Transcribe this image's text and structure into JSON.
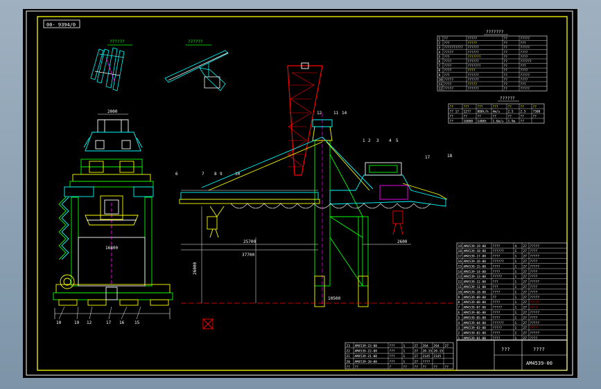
{
  "drawing": {
    "corner_code": "00- 9394/0",
    "sketch_label_1": "??????",
    "sketch_label_2": "??????",
    "spec_table_title": "???????",
    "param_table_title": "??????",
    "drawing_number": "AM4539-00",
    "title_block_name": "????",
    "title_block_name2": "???"
  },
  "dimensions": {
    "left_top": "2000",
    "left_mid": "16800",
    "main_span": "25700",
    "sub_span": "37700",
    "right_small": "2600",
    "vertical": "26000",
    "bottom_mid": "10500"
  },
  "callouts": {
    "side_view": [
      "1",
      "2",
      "3",
      "4",
      "5",
      "6",
      "7",
      "8",
      "9",
      "10",
      "11",
      "12",
      "13",
      "14",
      "17",
      "18"
    ],
    "front_view": [
      "10",
      "19",
      "12",
      "17",
      "16",
      "15"
    ]
  },
  "spec_table": [
    [
      "1",
      "??",
      "?????",
      "??",
      "?????"
    ],
    [
      "2",
      "???",
      "?????",
      "??",
      "???"
    ],
    [
      "3",
      "??????????",
      "??????",
      "??",
      "?????"
    ],
    [
      "4",
      "?????",
      "??????",
      "??",
      "????"
    ],
    [
      "5",
      "???",
      "???????",
      "??",
      "????"
    ],
    [
      "6",
      "????",
      "??????",
      "??",
      "??????"
    ],
    [
      "7",
      "????",
      "???????",
      "??",
      "???"
    ],
    [
      "8",
      "????",
      "????",
      "??",
      "????"
    ],
    [
      "9",
      "???",
      "??????",
      "??",
      "?????"
    ],
    [
      "10",
      "?????",
      "??????",
      "??",
      "????"
    ],
    [
      "11",
      "????",
      "?????",
      "??",
      "???"
    ],
    [
      "12",
      "?????",
      "??????",
      "??",
      "?????"
    ]
  ],
  "param_table": [
    [
      "??",
      "???",
      "???",
      "???",
      "??",
      "??",
      "??"
    ],
    [
      "?? 1?",
      "12??",
      "800t/h",
      "4m/s",
      "2.5",
      "2.5",
      "?500"
    ],
    [
      "??",
      "??",
      "??",
      "??",
      "??",
      "??",
      "??"
    ],
    [
      "??",
      "16000",
      "1400t",
      "1.6m/s",
      "1.9m",
      "??"
    ]
  ],
  "parts_list": [
    [
      "19",
      "AM4539-19-00",
      "????",
      "4",
      "27",
      "?????"
    ],
    [
      "18",
      "AM4539-18-00",
      "??????",
      "1",
      "27",
      "????"
    ],
    [
      "17",
      "AM4539-17-00",
      "????",
      "1",
      "27",
      "?????"
    ],
    [
      "16",
      "AM4539-16-00",
      "??????",
      "1",
      "27",
      "????"
    ],
    [
      "15",
      "AM4539-15-00",
      "????",
      "1",
      "27",
      "?????"
    ],
    [
      "14",
      "AM4539-14-00",
      "????",
      "1",
      "27",
      "????"
    ],
    [
      "13",
      "AM4539-13-00",
      "?????",
      "1",
      "27",
      "????"
    ],
    [
      "12",
      "AM4539-12-00",
      "???",
      "1",
      "27",
      "?????"
    ],
    [
      "11",
      "AM4539-11-00",
      "???",
      "1",
      "27",
      "????"
    ],
    [
      "10",
      "AM4539-10-00",
      "????",
      "1",
      "27",
      "????"
    ],
    [
      "9",
      "AM4539-09-00",
      "??",
      "1",
      "27",
      "?????"
    ],
    [
      "8",
      "AM4539-08-00",
      "????",
      "1",
      "27",
      "?????"
    ],
    [
      "7",
      "AM4539-07-00",
      "?????",
      "1",
      "27",
      "????"
    ],
    [
      "6",
      "AM4539-06-00",
      "????",
      "1",
      "27",
      "?????"
    ],
    [
      "5",
      "AM4539-05-00",
      "????",
      "1",
      "27",
      "????"
    ],
    [
      "4",
      "AM4539-04-00",
      "??????",
      "1",
      "27",
      "?????"
    ],
    [
      "3",
      "AM4539-03-00",
      "?????",
      "1",
      "27",
      "????"
    ],
    [
      "2",
      "AM4539-02-00",
      "????",
      "1",
      "27",
      "?????"
    ],
    [
      "1",
      "AM4539-01-00",
      "????",
      "1",
      "27",
      "????"
    ]
  ],
  "revision_rows": [
    [
      "23",
      "AM4539-23-00",
      "???",
      "1",
      "27",
      "264",
      "264",
      "27"
    ],
    [
      "22",
      "AM4539-22-00",
      "???",
      "1",
      "27",
      "20.15",
      "20.15",
      ""
    ],
    [
      "21",
      "AM4539-21-00",
      "???",
      "1",
      "27",
      "2145",
      "2145",
      ""
    ],
    [
      "20",
      "AM4539-20-00",
      "???",
      "1",
      "27",
      "????",
      "",
      ""
    ],
    [
      "??",
      "??",
      "?",
      "??",
      "??",
      "??",
      "??",
      "??"
    ]
  ]
}
